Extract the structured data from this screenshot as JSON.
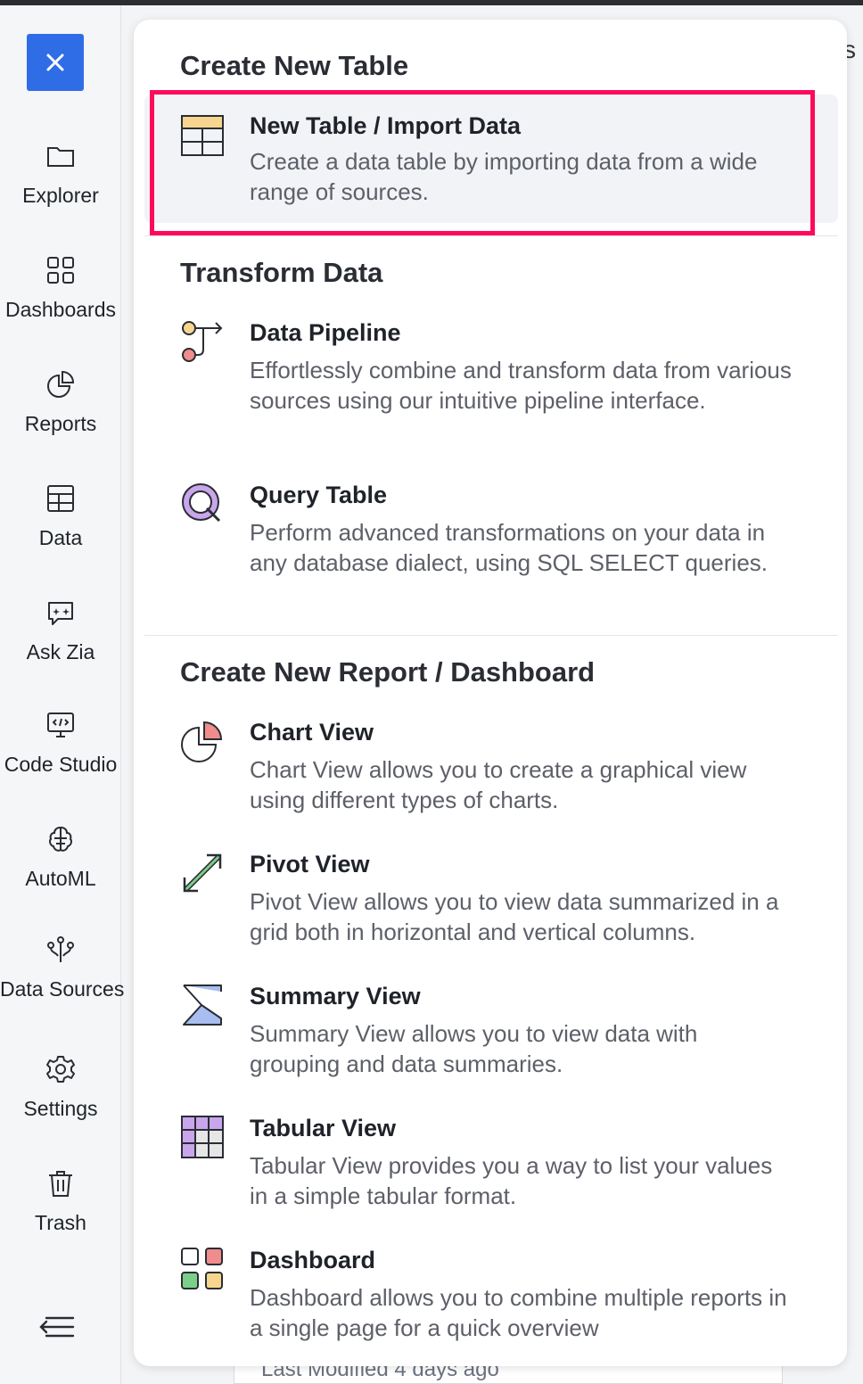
{
  "sidebar": {
    "items": [
      {
        "label": "Explorer",
        "icon": "folder-icon"
      },
      {
        "label": "Dashboards",
        "icon": "dashboards-grid-icon"
      },
      {
        "label": "Reports",
        "icon": "pie-chart-icon"
      },
      {
        "label": "Data",
        "icon": "table-icon"
      },
      {
        "label": "Ask Zia",
        "icon": "zia-chat-icon"
      },
      {
        "label": "Code Studio",
        "icon": "code-monitor-icon"
      },
      {
        "label": "AutoML",
        "icon": "automl-brain-icon"
      },
      {
        "label": "Data Sources",
        "icon": "data-sources-icon"
      },
      {
        "label": "Settings",
        "icon": "gear-icon"
      },
      {
        "label": "Trash",
        "icon": "trash-icon"
      }
    ]
  },
  "panel": {
    "sections": [
      {
        "title": "Create New Table"
      },
      {
        "title": "Transform Data"
      },
      {
        "title": "Create New Report / Dashboard"
      }
    ],
    "items": {
      "new_table": {
        "title": "New Table / Import Data",
        "desc": "Create a data table by importing data from a wide range of sources.",
        "icon": "table-import-icon"
      },
      "data_pipeline": {
        "title": "Data Pipeline",
        "desc": "Effortlessly combine and transform data from various sources using our intuitive pipeline interface.",
        "icon": "pipeline-icon"
      },
      "query_table": {
        "title": "Query Table",
        "desc": "Perform advanced transformations on your data in any database dialect, using SQL SELECT queries.",
        "icon": "query-icon"
      },
      "chart_view": {
        "title": "Chart View",
        "desc": "Chart View allows you to create a graphical view using different types of charts.",
        "icon": "pie-chart-icon"
      },
      "pivot_view": {
        "title": "Pivot View",
        "desc": "Pivot View allows you to view data summarized in a grid both in horizontal and vertical columns.",
        "icon": "pivot-arrow-icon"
      },
      "summary_view": {
        "title": "Summary View",
        "desc": "Summary View allows you to view data with grouping and data summaries.",
        "icon": "sigma-icon"
      },
      "tabular_view": {
        "title": "Tabular View",
        "desc": "Tabular View provides you a way to list your values in a simple tabular format.",
        "icon": "tabular-grid-icon"
      },
      "dashboard": {
        "title": "Dashboard",
        "desc": "Dashboard allows you to combine multiple reports in a single page for a quick overview",
        "icon": "dashboard-tiles-icon"
      }
    }
  },
  "background": {
    "last_modified": "Last Modified 4 days ago"
  },
  "colors": {
    "accent": "#2f6de6",
    "highlight": "#ff0a5a"
  }
}
